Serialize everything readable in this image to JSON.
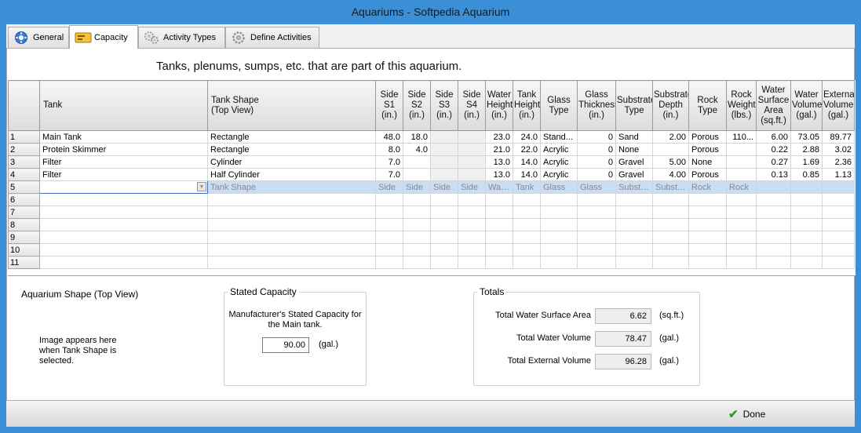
{
  "window": {
    "title": "Aquariums  -  Softpedia Aquarium"
  },
  "tabs": [
    {
      "label": "General",
      "icon": "general-icon"
    },
    {
      "label": "Capacity",
      "icon": "capacity-icon"
    },
    {
      "label": "Activity Types",
      "icon": "gears-icon"
    },
    {
      "label": "Define Activities",
      "icon": "gear-icon"
    }
  ],
  "heading": "Tanks, plenums, sumps, etc. that are part of this aquarium.",
  "grid": {
    "columns": [
      "Tank",
      "Tank Shape\n(Top View)",
      "Side S1 (in.)",
      "Side S2 (in.)",
      "Side S3 (in.)",
      "Side S4 (in.)",
      "Water Height (in.)",
      "Tank Height (in.)",
      "Glass Type",
      "Glass Thickness (in.)",
      "Substrate Type",
      "Substrate Depth (in.)",
      "Rock Type",
      "Rock Weight (lbs.)",
      "Water Surface Area (sq.ft.)",
      "Water Volume (gal.)",
      "External Volume (gal.)"
    ],
    "rows": [
      [
        "1",
        "Main Tank",
        "Rectangle",
        "48.0",
        "18.0",
        "",
        "",
        "23.0",
        "24.0",
        "Stand...",
        "0",
        "Sand",
        "2.00",
        "Porous",
        "110...",
        "6.00",
        "73.05",
        "89.77"
      ],
      [
        "2",
        "Protein Skimmer",
        "Rectangle",
        "8.0",
        "4.0",
        "",
        "",
        "21.0",
        "22.0",
        "Acrylic",
        "0",
        "None",
        "",
        "Porous",
        "",
        "0.22",
        "2.88",
        "3.02"
      ],
      [
        "3",
        "Filter",
        "Cylinder",
        "7.0",
        "",
        "",
        "",
        "13.0",
        "14.0",
        "Acrylic",
        "0",
        "Gravel",
        "5.00",
        "None",
        "",
        "0.27",
        "1.69",
        "2.36"
      ],
      [
        "4",
        "Filter",
        "Half Cylinder",
        "7.0",
        "",
        "",
        "",
        "13.0",
        "14.0",
        "Acrylic",
        "0",
        "Gravel",
        "4.00",
        "Porous",
        "",
        "0.13",
        "0.85",
        "1.13"
      ]
    ],
    "new_row": [
      "5",
      "",
      "Tank Shape",
      "Side",
      "Side",
      "Side",
      "Side",
      "Water",
      "Tank",
      "Glass",
      "Glass",
      "Substr...",
      "Subst...",
      "Rock",
      "Rock",
      "",
      "",
      ""
    ],
    "empty_rows": [
      "6",
      "7",
      "8",
      "9",
      "10",
      "11"
    ]
  },
  "aquarium_shape": {
    "title": "Aquarium Shape  (Top View)",
    "hint": "Image appears here when Tank Shape is selected."
  },
  "stated_capacity": {
    "legend": "Stated Capacity",
    "description": "Manufacturer's Stated Capacity for the Main tank.",
    "value": "90.00",
    "unit": "(gal.)"
  },
  "totals": {
    "legend": "Totals",
    "rows": [
      {
        "label": "Total Water Surface Area",
        "value": "6.62",
        "unit": "(sq.ft.)"
      },
      {
        "label": "Total Water Volume",
        "value": "78.47",
        "unit": "(gal.)"
      },
      {
        "label": "Total External Volume",
        "value": "96.28",
        "unit": "(gal.)"
      }
    ]
  },
  "footer": {
    "done_label": "Done"
  },
  "colors": {
    "window_frame": "#3b8fd6",
    "selected_row": "#c9def5",
    "done_check": "#2c9a2c"
  }
}
